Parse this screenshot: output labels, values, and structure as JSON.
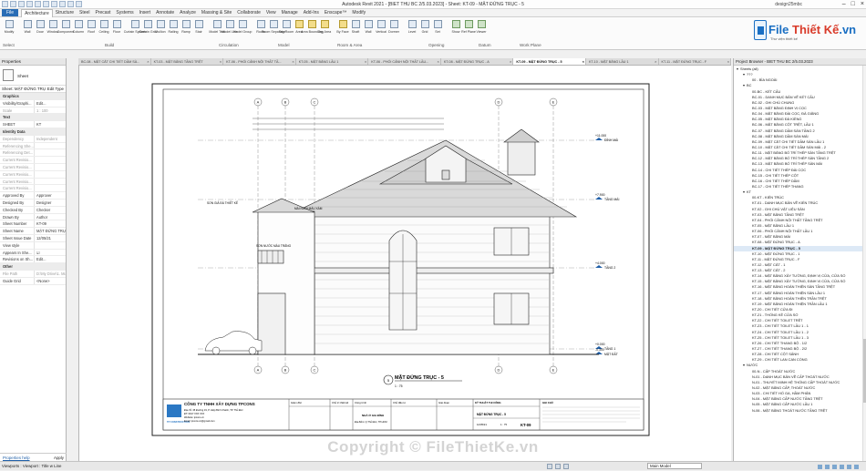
{
  "app": {
    "title": "Autodesk Revit 2021 - [BIET THU BC 2/5.03.2023] - Sheet: KT-09 - MẶT ĐỨNG TRỤC - 5",
    "user": "design25mbc"
  },
  "ribbon": {
    "file_tab": "File",
    "tabs": [
      "Architecture",
      "Structure",
      "Steel",
      "Precast",
      "Systems",
      "Insert",
      "Annotate",
      "Analyze",
      "Massing & Site",
      "Collaborate",
      "View",
      "Manage",
      "Add-Ins",
      "Enscape™",
      "Modify"
    ],
    "active_tab": "Architecture",
    "tools": [
      "Modify",
      "Wall",
      "Door",
      "Window",
      "Component",
      "Column",
      "Roof",
      "Ceiling",
      "Floor",
      "Curtain System",
      "Curtain Grid",
      "Mullion",
      "Railing",
      "Ramp",
      "Stair",
      "Model Text",
      "Model Line",
      "Model Group",
      "Room",
      "Room Separator",
      "Tag Room",
      "Area",
      "Area Boundary",
      "Tag Area",
      "By Face",
      "Shaft",
      "Wall",
      "Vertical",
      "Dormer",
      "Level",
      "Grid",
      "Set",
      "Show",
      "Ref Plane",
      "Viewer"
    ],
    "groups": [
      "Select",
      "Build",
      "Circulation",
      "Model",
      "Room & Area",
      "Opening",
      "Datum",
      "Work Plane"
    ]
  },
  "logo": {
    "brand_a": "File",
    "brand_b": "Thiết Kế",
    "suffix": ".vn",
    "sub": "Thư viện thiết kế"
  },
  "properties": {
    "title": "Properties",
    "type_name": "Sheet",
    "selector": "Sheet: MẶT ĐỨNG TRỤ",
    "edit_type": "Edit Type",
    "rows": [
      {
        "k": "Graphics",
        "v": "",
        "cat": true
      },
      {
        "k": "Visibility/Graphi...",
        "v": "Edit..."
      },
      {
        "k": "Scale",
        "v": "1 : 100",
        "dim": true
      },
      {
        "k": "Text",
        "v": "",
        "cat": true
      },
      {
        "k": "SHEET",
        "v": "KT"
      },
      {
        "k": "Identity Data",
        "v": "",
        "cat": true
      },
      {
        "k": "Dependency",
        "v": "Independent",
        "dim": true
      },
      {
        "k": "Referencing She...",
        "v": "",
        "dim": true
      },
      {
        "k": "Referencing Det...",
        "v": "",
        "dim": true
      },
      {
        "k": "Current Revisio...",
        "v": "",
        "dim": true
      },
      {
        "k": "Current Revisio...",
        "v": "",
        "dim": true
      },
      {
        "k": "Current Revisio...",
        "v": "",
        "dim": true
      },
      {
        "k": "Current Revisio...",
        "v": "",
        "dim": true
      },
      {
        "k": "Current Revisio...",
        "v": "",
        "dim": true
      },
      {
        "k": "Approved By",
        "v": "Approver"
      },
      {
        "k": "Designed By",
        "v": "Designer"
      },
      {
        "k": "Checked By",
        "v": "Checker"
      },
      {
        "k": "Drawn By",
        "v": "Author"
      },
      {
        "k": "Sheet Number",
        "v": "KT-09"
      },
      {
        "k": "Sheet Name",
        "v": "MẶT ĐỨNG TRỤ..."
      },
      {
        "k": "Sheet Issue Date",
        "v": "12/05/21"
      },
      {
        "k": "View style",
        "v": ""
      },
      {
        "k": "Appears In She...",
        "v": "☑"
      },
      {
        "k": "Revisions on Sh...",
        "v": "Edit..."
      },
      {
        "k": "Other",
        "v": "",
        "cat": true
      },
      {
        "k": "File Path",
        "v": "D:\\My Drive\\1. Mi...",
        "dim": true
      },
      {
        "k": "Guide Grid",
        "v": "<None>"
      }
    ],
    "help": "Properties help",
    "apply": "Apply"
  },
  "view_tabs": [
    {
      "label": "BC-08 - MẶT CẮT CHI TIẾT DẦM SÀ..."
    },
    {
      "label": "KT-03 - MẶT BẰNG TẦNG TRỆT"
    },
    {
      "label": "KT-06 - PHỐI CẢNH NỘI THẤT TẦ..."
    },
    {
      "label": "KT-05 - MẶT BẰNG LẦU 1"
    },
    {
      "label": "KT-06 - PHỐI CẢNH NỘI THẤT LẦU..."
    },
    {
      "label": "KT-08 - MẶT ĐỨNG TRỤC - A"
    },
    {
      "label": "KT-09 - MẶT ĐỨNG TRỤC - 5",
      "active": true
    },
    {
      "label": "KT-10 - MẶT BẰNG LẦU 1"
    },
    {
      "label": "KT-11 - MẶT ĐỨNG TRỤC - F"
    }
  ],
  "drawing": {
    "grid_labels": [
      "A",
      "B",
      "C",
      "D",
      "E"
    ],
    "level_labels": [
      {
        "value": "+11.000",
        "name": "ĐỈNH MÁI"
      },
      {
        "value": "+7.900",
        "name": "TẦNG MÁI"
      },
      {
        "value": "+4.000",
        "name": "TẦNG 2"
      },
      {
        "value": "+0.000",
        "name": "TẦNG 1"
      },
      {
        "value": "-0.300",
        "name": "MẶT ĐẤT"
      }
    ],
    "notes": [
      "SƠN GIẢ ĐÁ THIẾT KẾ",
      "MÁI NGÓI MÀU XÁM",
      "SƠN NƯỚC MÀU TRẮNG"
    ],
    "view_number": "5",
    "view_title": "MẶT ĐỨNG TRỤC - 5",
    "view_scale": "1 : 75",
    "company": "CÔNG TY TNHH XÂY DỰNG TPCONS",
    "address": "Địa chỉ: 45 Đường 19, P. Hiệp Bình Chánh, TP. Thủ Đức",
    "phone": "ĐT: 0917 XXX XXX",
    "website": "Website: tpcons.vn",
    "email": "Email: tpcons.vn@gmail.com",
    "logo_caption": "TP CONSTRUCTION",
    "columns": [
      "Giám đốc",
      "Chủ trì thiết kế",
      "Công trình",
      "Chủ đầu tư",
      "Giai đoạn",
      "KỸ THUẬT THI CÔNG",
      "GHI CHÚ"
    ],
    "project": "NHÀ Ở GIA ĐÌNH",
    "location": "Địa điểm: Q.Thủ Đức, TP.HCM",
    "sheet_name": "MẶT ĐỨNG TRỤC - 5",
    "sheet_number": "KT-09",
    "date": "12/05/21",
    "scale_tb": "1 : 75"
  },
  "project_browser": {
    "title": "Project Browser - BIET THU BC 2/5.03.2023",
    "items": [
      {
        "label": "Sheets (all)",
        "lvl": 0,
        "tog": "−"
      },
      {
        "label": "???",
        "lvl": 1,
        "tog": "−"
      },
      {
        "label": "00 - BÌA NGOÀI",
        "lvl": 2
      },
      {
        "label": "BC",
        "lvl": 1,
        "tog": "−"
      },
      {
        "label": "00-BC - KẾT CẤU",
        "lvl": 2
      },
      {
        "label": "BC-01 - DANH MỤC BẢN VẼ KẾT CẤU",
        "lvl": 2
      },
      {
        "label": "BC-02 - GHI CHÚ CHUNG",
        "lvl": 2
      },
      {
        "label": "BC-03 - MẶT BẰNG ĐỊNH VỊ CỌC",
        "lvl": 2
      },
      {
        "label": "BC-04 - MẶT BẰNG ĐÀI CỌC, ĐÀ GIẰNG",
        "lvl": 2
      },
      {
        "label": "BC-05 - MẶT BẰNG ĐÀ KIỀNG",
        "lvl": 2
      },
      {
        "label": "BC-06 - MẶT BẰNG CỘT TRỆT, LẦU 1",
        "lvl": 2
      },
      {
        "label": "BC-07 - MẶT BẰNG DẦM SÀN TẦNG 2",
        "lvl": 2
      },
      {
        "label": "BC-08 - MẶT BẰNG DẦM SÀN MÁI",
        "lvl": 2
      },
      {
        "label": "BC-09 - MẶT CẮT CHI TIẾT DẦM SÀN LẦU 1",
        "lvl": 2
      },
      {
        "label": "BC-10 - MẶT CẮT CHI TIẾT DẦM SÀN MÁI - 2",
        "lvl": 2
      },
      {
        "label": "BC-11 - MẶT BẰNG BỐ TRÍ THÉP SÀN TẦNG TRỆT",
        "lvl": 2
      },
      {
        "label": "BC-12 - MẶT BẰNG BỐ TRÍ THÉP SÀN TẦNG 2",
        "lvl": 2
      },
      {
        "label": "BC-13 - MẶT BẰNG BỐ TRÍ THÉP SÀN MÁI",
        "lvl": 2
      },
      {
        "label": "BC-14 - CHI TIẾT THÉP ĐÀI CỌC",
        "lvl": 2
      },
      {
        "label": "BC-15 - CHI TIẾT THÉP CỘT",
        "lvl": 2
      },
      {
        "label": "BC-16 - CHI TIẾT THÉP DẦM",
        "lvl": 2
      },
      {
        "label": "BC-17 - CHI TIẾT THÉP THANG",
        "lvl": 2
      },
      {
        "label": "KT",
        "lvl": 1,
        "tog": "−"
      },
      {
        "label": "00-KT - KIẾN TRÚC",
        "lvl": 2
      },
      {
        "label": "KT-01 - DANH MỤC BẢN VẼ KIẾN TRÚC",
        "lvl": 2
      },
      {
        "label": "KT-02 - GHI CHÚ VẬT LIỆU SÀN",
        "lvl": 2
      },
      {
        "label": "KT-03 - MẶT BẰNG TẦNG TRỆT",
        "lvl": 2
      },
      {
        "label": "KT-04 - PHỐI CẢNH NỘI THẤT TẦNG TRỆT",
        "lvl": 2
      },
      {
        "label": "KT-05 - MẶT BẰNG LẦU 1",
        "lvl": 2
      },
      {
        "label": "KT-06 - PHỐI CẢNH NỘI THẤT LẦU 1",
        "lvl": 2
      },
      {
        "label": "KT-07 - MẶT BẰNG MÁI",
        "lvl": 2
      },
      {
        "label": "KT-08 - MẶT ĐỨNG TRỤC - A",
        "lvl": 2
      },
      {
        "label": "KT-09 - MẶT ĐỨNG TRỤC - 5",
        "lvl": 2,
        "on": true
      },
      {
        "label": "KT-10 - MẶT ĐỨNG TRỤC - 1",
        "lvl": 2
      },
      {
        "label": "KT-11 - MẶT ĐỨNG TRỤC - F",
        "lvl": 2
      },
      {
        "label": "KT-12 - MẶT CẮT - 1",
        "lvl": 2
      },
      {
        "label": "KT-13 - MẶT CẮT - 2",
        "lvl": 2
      },
      {
        "label": "KT-14 - MẶT BẰNG XÂY TƯỜNG, ĐỊNH VỊ CỬA, CỬA SỔ",
        "lvl": 2
      },
      {
        "label": "KT-15 - MẶT BẰNG XÂY TƯỜNG, ĐỊNH VỊ CỬA, CỬA SỔ",
        "lvl": 2
      },
      {
        "label": "KT-16 - MẶT BẰNG HOÀN THIỆN SÀN TẦNG TRỆT",
        "lvl": 2
      },
      {
        "label": "KT-17 - MẶT BẰNG HOÀN THIỆN SÀN LẦU 1",
        "lvl": 2
      },
      {
        "label": "KT-18 - MẶT BẰNG HOÀN THIỆN TRẦN TRỆT",
        "lvl": 2
      },
      {
        "label": "KT-19 - MẶT BẰNG HOÀN THIỆN TRẦN LẦU 1",
        "lvl": 2
      },
      {
        "label": "KT-20 - CHI TIẾT CỬA ĐI",
        "lvl": 2
      },
      {
        "label": "KT-21 - THỐNG KÊ CỬA SỔ",
        "lvl": 2
      },
      {
        "label": "KT-22 - CHI TIẾT TOILET TRỆT",
        "lvl": 2
      },
      {
        "label": "KT-23 - CHI TIẾT TOILET LẦU 1 - 1",
        "lvl": 2
      },
      {
        "label": "KT-24 - CHI TIẾT TOILET LẦU 1 - 2",
        "lvl": 2
      },
      {
        "label": "KT-25 - CHI TIẾT TOILET LẦU 1 - 3",
        "lvl": 2
      },
      {
        "label": "KT-26 - CHI TIẾT THANG BỘ - 1/2",
        "lvl": 2
      },
      {
        "label": "KT-27 - CHI TIẾT THANG BỘ - 2/2",
        "lvl": 2
      },
      {
        "label": "KT-28 - CHI TIẾT CỘT SẢNH",
        "lvl": 2
      },
      {
        "label": "KT-29 - CHI TIẾT LAN CAN CỔNG",
        "lvl": 2
      },
      {
        "label": "NƯỚC",
        "lvl": 1,
        "tog": "−"
      },
      {
        "label": "00-N - CẤP THOÁT NƯỚC",
        "lvl": 2
      },
      {
        "label": "N-01 - DANH MỤC BẢN VẼ CẤP THOÁT NƯỚC",
        "lvl": 2
      },
      {
        "label": "N-01 - THUYẾT MINH HỆ THỐNG CẤP THOÁT NƯỚC",
        "lvl": 2
      },
      {
        "label": "N-02 - MẶT BẰNG CẤP, THOÁT NƯỚC",
        "lvl": 2
      },
      {
        "label": "N-03 - CHI TIẾT HỐ GA, HẦM PHÂN",
        "lvl": 2
      },
      {
        "label": "N-04 - MẶT BẰNG CẤP NƯỚC TẦNG TRỆT",
        "lvl": 2
      },
      {
        "label": "N-05 - MẶT BẰNG CẤP NƯỚC LẦU 1",
        "lvl": 2
      },
      {
        "label": "N-06 - MẶT BẰNG THOÁT NƯỚC TẦNG TRỆT",
        "lvl": 2
      }
    ]
  },
  "status": {
    "left": "Viewports : Viewport : Title w Line",
    "model": "Main Model"
  },
  "watermark": "Copyright © FileThietKe.vn"
}
